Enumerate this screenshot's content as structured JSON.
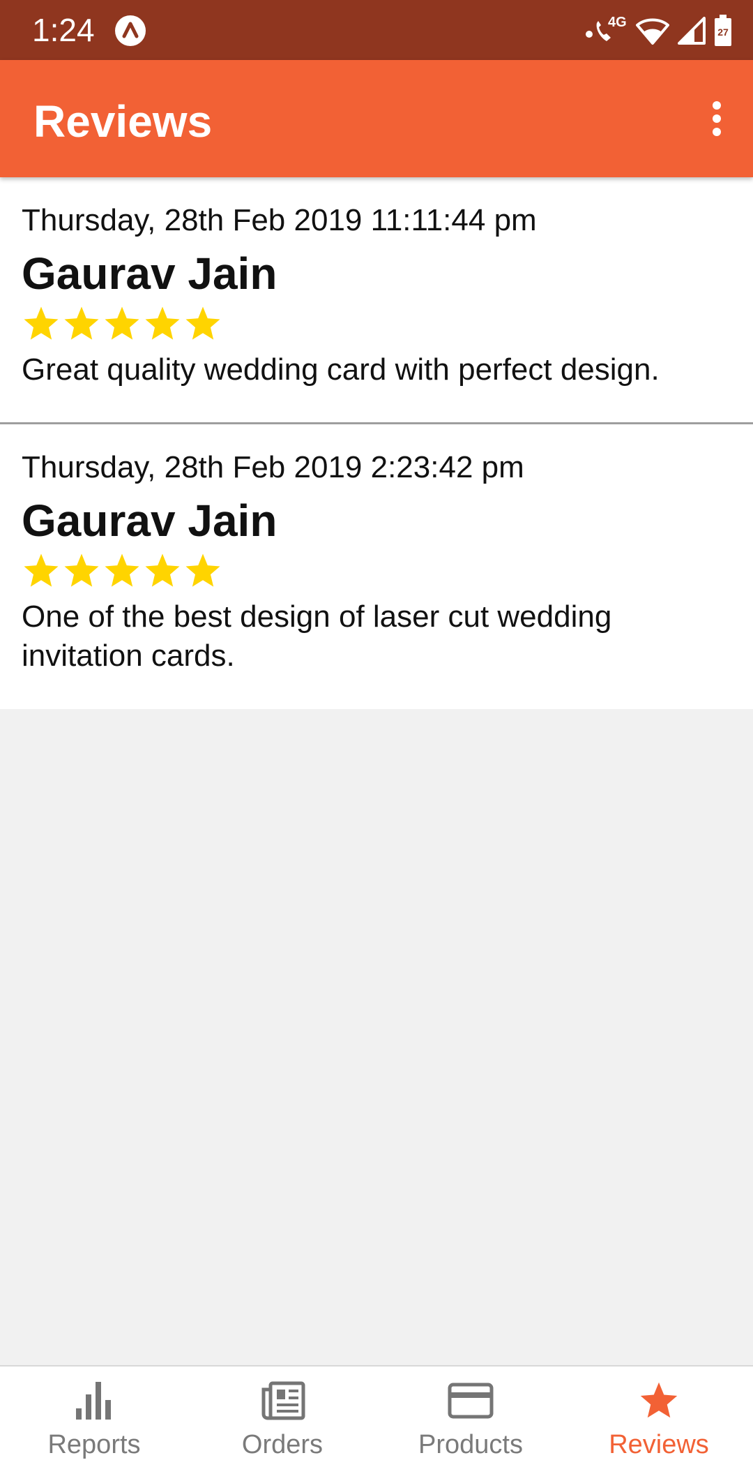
{
  "status_bar": {
    "time": "1:24",
    "network_label": "4G",
    "battery_level": "27",
    "icons": [
      "app-notification-icon",
      "wifi-call-icon",
      "wifi-icon",
      "signal-icon",
      "battery-icon"
    ]
  },
  "app_bar": {
    "title": "Reviews",
    "menu_icon": "more-vert-icon",
    "background_color": "#f26135"
  },
  "reviews": [
    {
      "date": "Thursday, 28th Feb 2019 11:11:44 pm",
      "name": "Gaurav Jain",
      "rating": 5,
      "rating_max": 5,
      "comment": "Great quality wedding card with perfect design."
    },
    {
      "date": "Thursday, 28th Feb 2019 2:23:42 pm",
      "name": "Gaurav Jain",
      "rating": 5,
      "rating_max": 5,
      "comment": "One of the best design of laser cut wedding invitation cards."
    }
  ],
  "bottom_nav": {
    "items": [
      {
        "label": "Reports",
        "icon": "bar-chart-icon",
        "active": false
      },
      {
        "label": "Orders",
        "icon": "orders-icon",
        "active": false
      },
      {
        "label": "Products",
        "icon": "credit-card-icon",
        "active": false
      },
      {
        "label": "Reviews",
        "icon": "star-icon",
        "active": true
      }
    ],
    "active_color": "#f26135",
    "inactive_color": "#7a7a7a"
  },
  "colors": {
    "status_bar": "#8f361f",
    "star": "#ffd400",
    "background": "#f1f1f1"
  }
}
